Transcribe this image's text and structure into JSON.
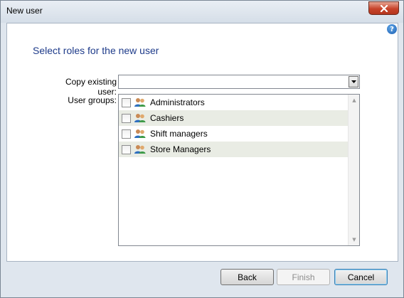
{
  "window": {
    "title": "New user"
  },
  "heading": "Select roles for the new user",
  "copy_existing_user": {
    "label": "Copy existing user:",
    "value": ""
  },
  "user_groups": {
    "label": "User groups:",
    "items": [
      {
        "label": "Administrators",
        "checked": false
      },
      {
        "label": "Cashiers",
        "checked": false
      },
      {
        "label": "Shift managers",
        "checked": false
      },
      {
        "label": "Store Managers",
        "checked": false
      }
    ]
  },
  "buttons": {
    "back": "Back",
    "finish": "Finish",
    "cancel": "Cancel"
  },
  "icons": {
    "close": "close-icon",
    "help": "help-icon",
    "group": "user-group-icon",
    "dropdown": "chevron-down-icon"
  },
  "colors": {
    "heading": "#1e3b8a",
    "alt_row": "#e9ece4",
    "close_button": "#c7432a"
  }
}
